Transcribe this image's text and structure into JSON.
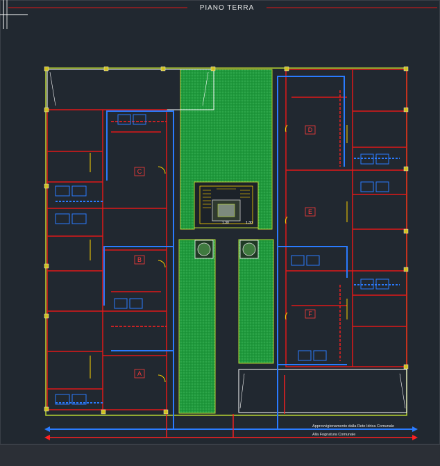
{
  "drawing": {
    "title": "PIANO  TERRA",
    "units": [
      "A",
      "B",
      "C",
      "D",
      "E",
      "F"
    ],
    "water_line_label": "Approvvigionamento dalla Rete Idrica Comunale",
    "sewer_line_label": "Alla Fognatura Comunale",
    "stair_dim_1": "1.30",
    "stair_dim_2": "1.30"
  },
  "colors": {
    "background": "#212830",
    "wall": "#e01818",
    "site_boundary": "#b8d432",
    "garden": "#1e9a3a",
    "water_pipe": "#2a7bff",
    "sewer_pipe": "#ff2020",
    "door": "#ffd400"
  }
}
